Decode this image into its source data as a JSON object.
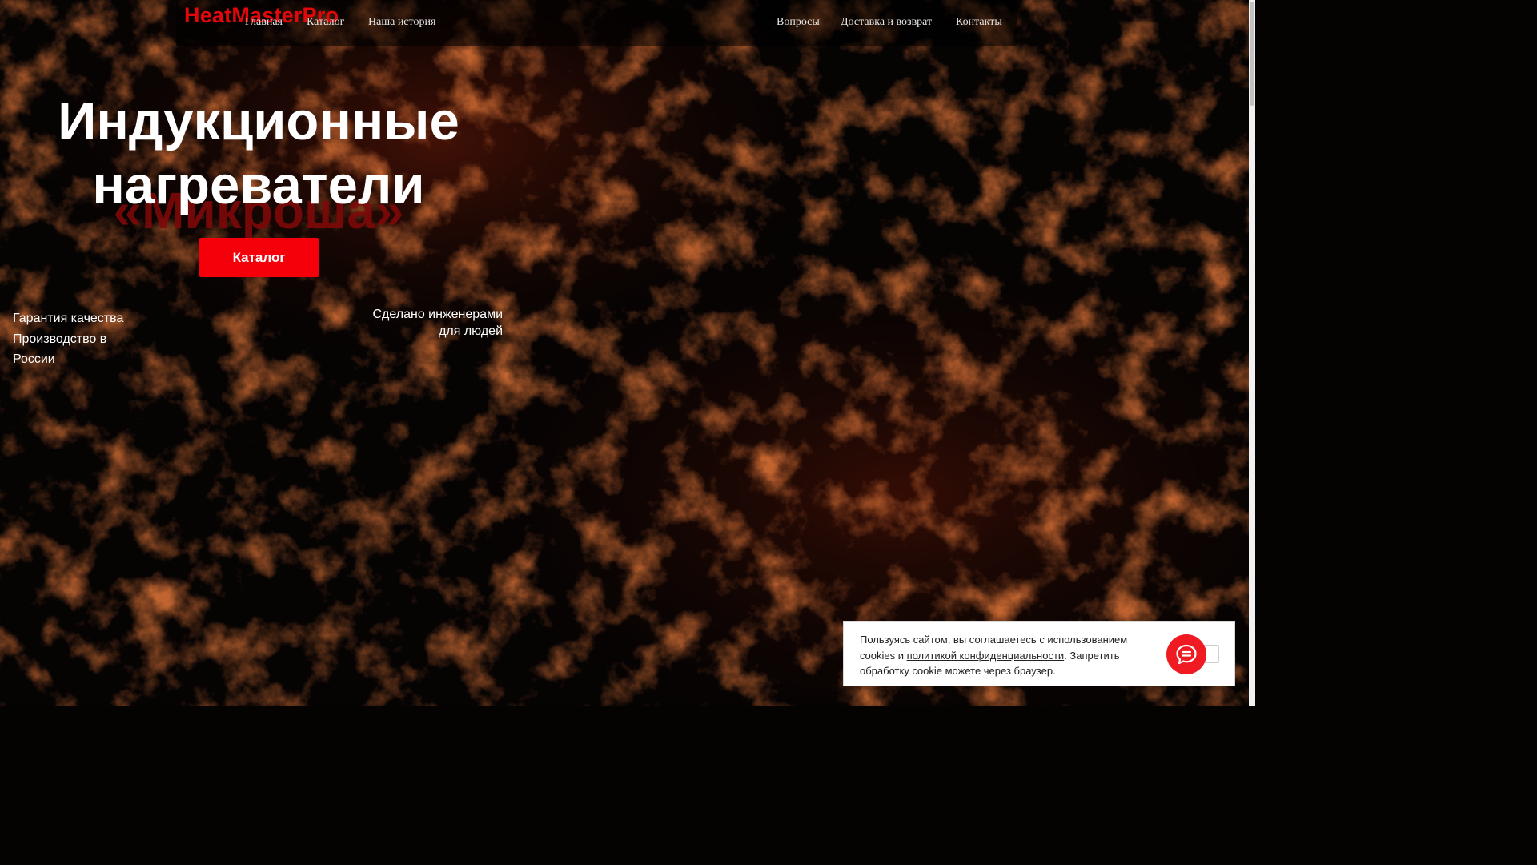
{
  "brand": {
    "logo": "HeatMasterPro",
    "accent": "#f5000a"
  },
  "nav": {
    "left": [
      {
        "label": "Главная",
        "active": true
      },
      {
        "label": "Каталог",
        "active": false
      },
      {
        "label": "Наша история",
        "active": false
      }
    ],
    "right": [
      {
        "label": "Вопросы"
      },
      {
        "label": "Доставка и возврат"
      },
      {
        "label": "Контакты"
      }
    ]
  },
  "hero": {
    "title_line1": "Индукционные",
    "title_line2": "нагреватели",
    "subtitle": "«Микроша»",
    "button": "Каталог"
  },
  "features": {
    "left_line1": "Гарантия качества",
    "left_line2": "Производство в",
    "left_line3": "России",
    "right_line1": "Сделано инженерами",
    "right_line2": "для людей"
  },
  "cookie": {
    "text_before": "Пользуясь сайтом, вы соглашаетесь с использованием cookies и ",
    "link": "политикой конфиденциальности",
    "text_after": ". Запретить обработку cookie можете через браузер."
  },
  "icons": {
    "chat": "chat-bubble-icon"
  }
}
